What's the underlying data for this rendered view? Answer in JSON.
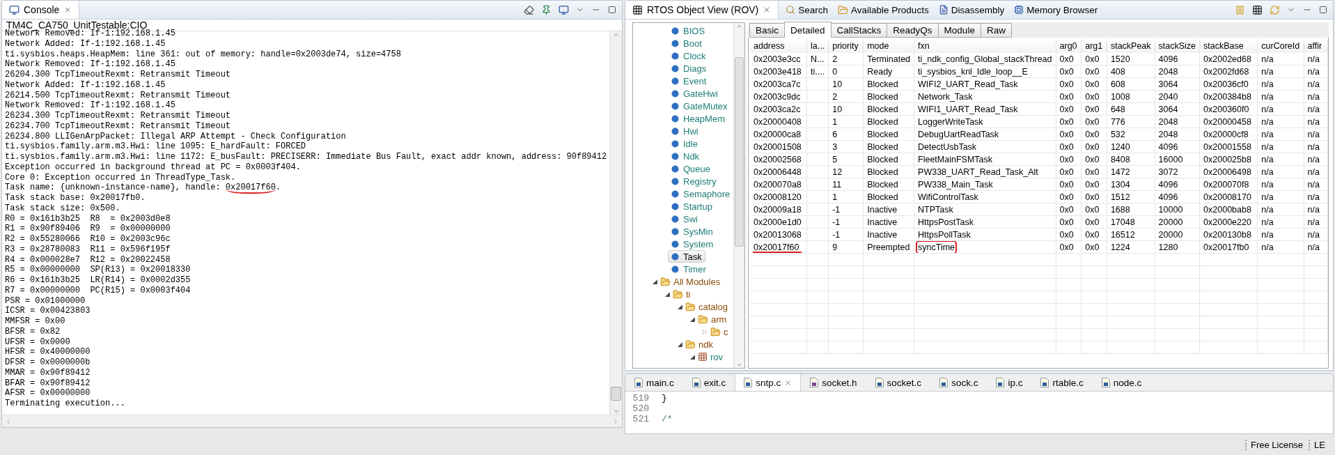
{
  "console": {
    "title": "Console",
    "subtitle": "TM4C_CA750_UnitTestable:CIO",
    "lines": [
      {
        "text": "Network Removed: If-1:192.168.1.45"
      },
      {
        "text": "Network Added: If-1:192.168.1.45"
      },
      {
        "text": "ti.sysbios.heaps.HeapMem: line 361: out of memory: handle=0x2003de74, size=4758"
      },
      {
        "text": "Network Removed: If-1:192.168.1.45"
      },
      {
        "text": "26204.300 TcpTimeoutRexmt: Retransmit Timeout"
      },
      {
        "text": "Network Added: If-1:192.168.1.45"
      },
      {
        "text": "26214.500 TcpTimeoutRexmt: Retransmit Timeout"
      },
      {
        "text": "Network Removed: If-1:192.168.1.45"
      },
      {
        "text": "26234.300 TcpTimeoutRexmt: Retransmit Timeout"
      },
      {
        "text": "26234.700 TcpTimeoutRexmt: Retransmit Timeout"
      },
      {
        "text": "26234.800 LLIGenArpPacket: Illegal ARP Attempt - Check Configuration"
      },
      {
        "text": "ti.sysbios.family.arm.m3.Hwi: line 1095: E_hardFault: FORCED"
      },
      {
        "text": "ti.sysbios.family.arm.m3.Hwi: line 1172: E_busFault: PRECISERR: Immediate Bus Fault, exact addr known, address: 90f89412"
      },
      {
        "text": "Exception occurred in background thread at PC = 0x0003f404."
      },
      {
        "text": "Core 0: Exception occurred in ThreadType_Task."
      },
      {
        "text": "Task name: {unknown-instance-name}, handle: ",
        "marked": "0x20017f60",
        "after": "."
      },
      {
        "text": "Task stack base: 0x20017fb0."
      },
      {
        "text": "Task stack size: 0x500."
      },
      {
        "text": "R0 = 0x161b3b25  R8  = 0x2003d0e8"
      },
      {
        "text": "R1 = 0x90f89406  R9  = 0x00000000"
      },
      {
        "text": "R2 = 0x55280066  R10 = 0x2003c96c"
      },
      {
        "text": "R3 = 0x28780083  R11 = 0x596f195f"
      },
      {
        "text": "R4 = 0x000028e7  R12 = 0x20022458"
      },
      {
        "text": "R5 = 0x00000000  SP(R13) = 0x20018330"
      },
      {
        "text": "R6 = 0x161b3b25  LR(R14) = 0x0002d355"
      },
      {
        "text": "R7 = 0x00000000  PC(R15) = 0x0003f404"
      },
      {
        "text": "PSR = 0x01000000"
      },
      {
        "text": "ICSR = 0x00423803"
      },
      {
        "text": "MMFSR = 0x00"
      },
      {
        "text": "BFSR = 0x82"
      },
      {
        "text": "UFSR = 0x0000"
      },
      {
        "text": "HFSR = 0x40000000"
      },
      {
        "text": "DFSR = 0x0000000b"
      },
      {
        "text": "MMAR = 0x90f89412"
      },
      {
        "text": "BFAR = 0x90f89412"
      },
      {
        "text": "AFSR = 0x00000000"
      },
      {
        "text": "Terminating execution..."
      }
    ]
  },
  "rov": {
    "title": "RTOS Object View (ROV)",
    "other_views": [
      {
        "label": "Search",
        "kind": "search"
      },
      {
        "label": "Available Products",
        "kind": "products"
      },
      {
        "label": "Disassembly",
        "kind": "disassembly"
      },
      {
        "label": "Memory Browser",
        "kind": "memory"
      }
    ],
    "tree": {
      "modules": [
        {
          "label": "BIOS",
          "selected": false
        },
        {
          "label": "Boot",
          "selected": false
        },
        {
          "label": "Clock",
          "selected": false
        },
        {
          "label": "Diags",
          "selected": false
        },
        {
          "label": "Event",
          "selected": false
        },
        {
          "label": "GateHwi",
          "selected": false
        },
        {
          "label": "GateMutex",
          "selected": false
        },
        {
          "label": "HeapMem",
          "selected": false
        },
        {
          "label": "Hwi",
          "selected": false
        },
        {
          "label": "Idle",
          "selected": false
        },
        {
          "label": "Ndk",
          "selected": false
        },
        {
          "label": "Queue",
          "selected": false
        },
        {
          "label": "Registry",
          "selected": false
        },
        {
          "label": "Semaphore",
          "selected": false
        },
        {
          "label": "Startup",
          "selected": false
        },
        {
          "label": "Swi",
          "selected": false
        },
        {
          "label": "SysMin",
          "selected": false
        },
        {
          "label": "System",
          "selected": false
        },
        {
          "label": "Task",
          "selected": true
        },
        {
          "label": "Timer",
          "selected": false
        }
      ],
      "folders": [
        {
          "label": "All Modules",
          "kind": "folder",
          "expander": "◢",
          "expanded": true,
          "children": [
            {
              "label": "ti",
              "kind": "folder",
              "expander": "◢",
              "expanded": true,
              "children": [
                {
                  "label": "catalog",
                  "kind": "folder",
                  "expander": "◢",
                  "expanded": true,
                  "children": [
                    {
                      "label": "arm",
                      "kind": "folder",
                      "expander": "◢",
                      "expanded": true,
                      "children": [
                        {
                          "label": "c",
                          "kind": "folder",
                          "expander": "▷",
                          "expanded": false
                        }
                      ]
                    }
                  ]
                },
                {
                  "label": "ndk",
                  "kind": "folder",
                  "expander": "◢",
                  "expanded": true,
                  "children": [
                    {
                      "label": "rov",
                      "kind": "module",
                      "expander": "◢",
                      "expanded": true
                    }
                  ]
                }
              ]
            }
          ]
        }
      ]
    },
    "tabs": [
      {
        "label": "Basic",
        "selected": false
      },
      {
        "label": "Detailed",
        "selected": true
      },
      {
        "label": "CallStacks",
        "selected": false
      },
      {
        "label": "ReadyQs",
        "selected": false
      },
      {
        "label": "Module",
        "selected": false
      },
      {
        "label": "Raw",
        "selected": false
      }
    ],
    "table": {
      "columns": [
        "address",
        "la...",
        "priority",
        "mode",
        "fxn",
        "arg0",
        "arg1",
        "stackPeak",
        "stackSize",
        "stackBase",
        "curCoreId",
        "affir"
      ],
      "rows": [
        {
          "cells": [
            "0x2003e3cc",
            "N...",
            "2",
            "Terminated",
            "ti_ndk_config_Global_stackThread",
            "0x0",
            "0x0",
            "1520",
            "4096",
            "0x2002ed68",
            "n/a",
            "n/a"
          ],
          "annotated": false
        },
        {
          "cells": [
            "0x2003e418",
            "ti....",
            "0",
            "Ready",
            "ti_sysbios_knl_Idle_loop__E",
            "0x0",
            "0x0",
            "408",
            "2048",
            "0x2002fd68",
            "n/a",
            "n/a"
          ],
          "annotated": false
        },
        {
          "cells": [
            "0x2003ca7c",
            "",
            "10",
            "Blocked",
            "WIFI2_UART_Read_Task",
            "0x0",
            "0x0",
            "608",
            "3064",
            "0x20036cf0",
            "n/a",
            "n/a"
          ],
          "annotated": false
        },
        {
          "cells": [
            "0x2003c9dc",
            "",
            "2",
            "Blocked",
            "Network_Task",
            "0x0",
            "0x0",
            "1008",
            "2040",
            "0x200384b8",
            "n/a",
            "n/a"
          ],
          "annotated": false
        },
        {
          "cells": [
            "0x2003ca2c",
            "",
            "10",
            "Blocked",
            "WIFI1_UART_Read_Task",
            "0x0",
            "0x0",
            "648",
            "3064",
            "0x200360f0",
            "n/a",
            "n/a"
          ],
          "annotated": false
        },
        {
          "cells": [
            "0x20000408",
            "",
            "1",
            "Blocked",
            "LoggerWriteTask",
            "0x0",
            "0x0",
            "776",
            "2048",
            "0x20000458",
            "n/a",
            "n/a"
          ],
          "annotated": false
        },
        {
          "cells": [
            "0x20000ca8",
            "",
            "6",
            "Blocked",
            "DebugUartReadTask",
            "0x0",
            "0x0",
            "532",
            "2048",
            "0x20000cf8",
            "n/a",
            "n/a"
          ],
          "annotated": false
        },
        {
          "cells": [
            "0x20001508",
            "",
            "3",
            "Blocked",
            "DetectUsbTask",
            "0x0",
            "0x0",
            "1240",
            "4096",
            "0x20001558",
            "n/a",
            "n/a"
          ],
          "annotated": false
        },
        {
          "cells": [
            "0x20002568",
            "",
            "5",
            "Blocked",
            "FleetMainFSMTask",
            "0x0",
            "0x0",
            "8408",
            "16000",
            "0x200025b8",
            "n/a",
            "n/a"
          ],
          "annotated": false
        },
        {
          "cells": [
            "0x20006448",
            "",
            "12",
            "Blocked",
            "PW338_UART_Read_Task_Alt",
            "0x0",
            "0x0",
            "1472",
            "3072",
            "0x20006498",
            "n/a",
            "n/a"
          ],
          "annotated": false
        },
        {
          "cells": [
            "0x200070a8",
            "",
            "11",
            "Blocked",
            "PW338_Main_Task",
            "0x0",
            "0x0",
            "1304",
            "4096",
            "0x200070f8",
            "n/a",
            "n/a"
          ],
          "annotated": false
        },
        {
          "cells": [
            "0x20008120",
            "",
            "1",
            "Blocked",
            "WifiControlTask",
            "0x0",
            "0x0",
            "1512",
            "4096",
            "0x20008170",
            "n/a",
            "n/a"
          ],
          "annotated": false
        },
        {
          "cells": [
            "0x20009a18",
            "",
            "-1",
            "Inactive",
            "NTPTask",
            "0x0",
            "0x0",
            "1688",
            "10000",
            "0x2000bab8",
            "n/a",
            "n/a"
          ],
          "annotated": false
        },
        {
          "cells": [
            "0x2000e1d0",
            "",
            "-1",
            "Inactive",
            "HttpsPostTask",
            "0x0",
            "0x0",
            "17048",
            "20000",
            "0x2000e220",
            "n/a",
            "n/a"
          ],
          "annotated": false
        },
        {
          "cells": [
            "0x20013068",
            "",
            "-1",
            "Inactive",
            "HttpsPollTask",
            "0x0",
            "0x0",
            "16512",
            "20000",
            "0x200130b8",
            "n/a",
            "n/a"
          ],
          "annotated": false
        },
        {
          "cells": [
            "0x20017f60",
            "",
            "9",
            "Preempted",
            "syncTime",
            "0x0",
            "0x0",
            "1224",
            "1280",
            "0x20017fb0",
            "n/a",
            "n/a"
          ],
          "annotated": true
        }
      ]
    }
  },
  "editor": {
    "tabs": [
      {
        "label": "main.c",
        "kind": "c",
        "selected": false
      },
      {
        "label": "exit.c",
        "kind": "c",
        "selected": false
      },
      {
        "label": "sntp.c",
        "kind": "c",
        "selected": true
      },
      {
        "label": "socket.h",
        "kind": "h",
        "selected": false
      },
      {
        "label": "socket.c",
        "kind": "c",
        "selected": false
      },
      {
        "label": "sock.c",
        "kind": "c",
        "selected": false
      },
      {
        "label": "ip.c",
        "kind": "c",
        "selected": false
      },
      {
        "label": "rtable.c",
        "kind": "c",
        "selected": false
      },
      {
        "label": "node.c",
        "kind": "c",
        "selected": false
      }
    ],
    "lines": [
      {
        "number": "519",
        "code": "}"
      },
      {
        "number": "520"
      },
      {
        "number": "521",
        "code": "/*"
      }
    ]
  },
  "status_bar": [
    "Free License",
    "LE"
  ]
}
